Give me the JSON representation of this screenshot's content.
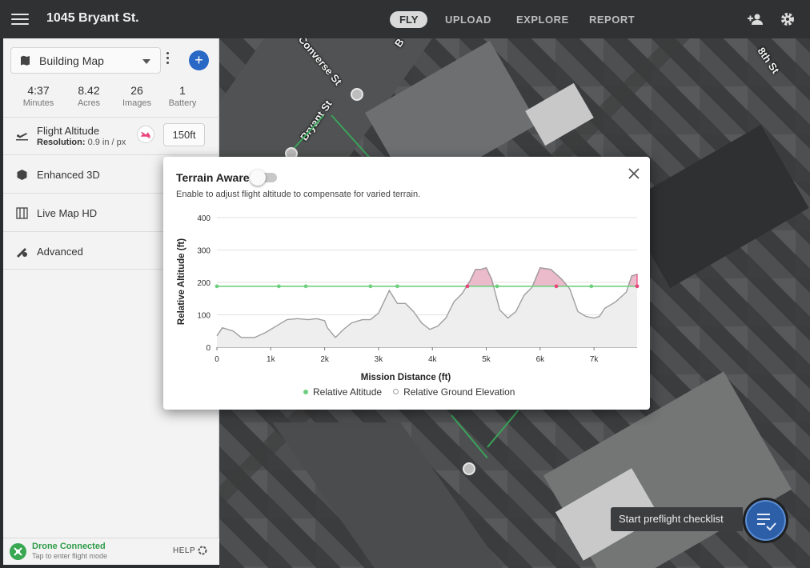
{
  "header": {
    "title": "1045 Bryant St.",
    "nav": [
      "FLY",
      "UPLOAD",
      "EXPLORE",
      "REPORT"
    ],
    "active_nav": "FLY"
  },
  "map": {
    "streets": [
      "Converse St",
      "Bryant St",
      "8th St",
      "B"
    ]
  },
  "sidebar": {
    "map_type": "Building Map",
    "stats": [
      {
        "value": "4:37",
        "label": "Minutes"
      },
      {
        "value": "8.42",
        "label": "Acres"
      },
      {
        "value": "26",
        "label": "Images"
      },
      {
        "value": "1",
        "label": "Battery"
      }
    ],
    "flight_altitude": {
      "label": "Flight Altitude",
      "resolution_label": "Resolution:",
      "resolution_value": "0.9 in / px",
      "value": "150ft"
    },
    "items": [
      {
        "label": "Enhanced 3D",
        "icon": "cube-icon"
      },
      {
        "label": "Live Map HD",
        "icon": "live-map-icon"
      },
      {
        "label": "Advanced",
        "icon": "advanced-settings-icon"
      }
    ]
  },
  "status": {
    "title": "Drone Connected",
    "subtitle": "Tap to enter flight mode",
    "help": "HELP"
  },
  "preflight": {
    "label": "Start preflight checklist"
  },
  "modal": {
    "title": "Terrain Aware",
    "toggle_on": false,
    "description": "Enable to adjust flight altitude to compensate for varied terrain."
  },
  "colors": {
    "altitude": "#6fcf7f",
    "ground": "#9e9e9e",
    "ground_fill": "#eeeeee",
    "conflict": "#e8457a",
    "accent": "#2a68c5"
  },
  "chart_data": {
    "type": "area",
    "title": "",
    "xlabel": "Mission Distance (ft)",
    "ylabel": "Relative Altitude (ft)",
    "xlim": [
      0,
      7800
    ],
    "ylim": [
      0,
      400
    ],
    "x_ticks": [
      "0",
      "1k",
      "2k",
      "3k",
      "4k",
      "5k",
      "6k",
      "7k"
    ],
    "x_tick_values": [
      0,
      1000,
      2000,
      3000,
      4000,
      5000,
      6000,
      7000
    ],
    "y_ticks": [
      0,
      100,
      200,
      300,
      400
    ],
    "legend_position": "bottom",
    "series": [
      {
        "name": "Relative Altitude",
        "x": [
          0,
          1150,
          1650,
          2850,
          3350,
          4650,
          5200,
          6300,
          6950,
          7800
        ],
        "y": [
          188,
          188,
          188,
          188,
          188,
          188,
          188,
          188,
          188,
          188
        ]
      },
      {
        "name": "Relative Ground Elevation",
        "x": [
          0,
          100,
          300,
          450,
          700,
          900,
          1100,
          1300,
          1500,
          1700,
          1850,
          2000,
          2050,
          2200,
          2350,
          2500,
          2700,
          2850,
          3000,
          3100,
          3200,
          3350,
          3500,
          3650,
          3800,
          3950,
          4100,
          4250,
          4400,
          4550,
          4700,
          4800,
          4900,
          5000,
          5100,
          5250,
          5400,
          5550,
          5700,
          5850,
          6000,
          6200,
          6400,
          6550,
          6700,
          6850,
          7000,
          7100,
          7200,
          7400,
          7600,
          7700,
          7800
        ],
        "y": [
          35,
          60,
          50,
          30,
          30,
          45,
          65,
          85,
          88,
          85,
          88,
          82,
          60,
          30,
          55,
          75,
          85,
          85,
          105,
          140,
          175,
          135,
          135,
          110,
          75,
          55,
          65,
          90,
          140,
          165,
          205,
          240,
          240,
          245,
          210,
          115,
          90,
          110,
          160,
          185,
          245,
          240,
          210,
          180,
          110,
          95,
          90,
          95,
          120,
          140,
          170,
          220,
          225
        ]
      }
    ]
  }
}
